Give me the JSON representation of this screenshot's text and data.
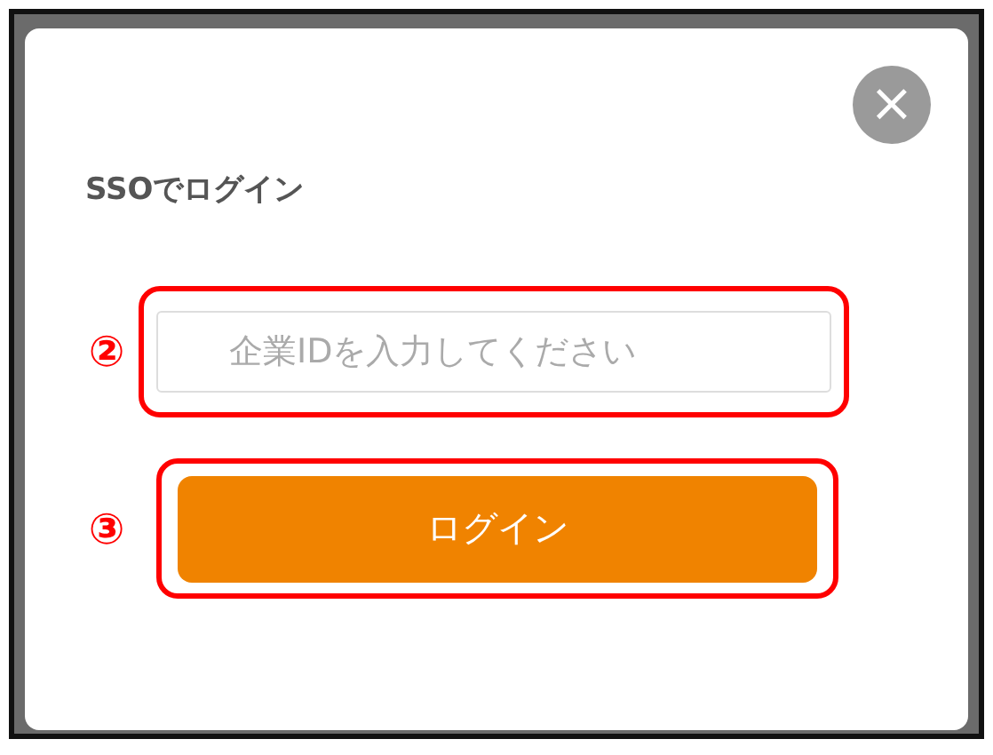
{
  "dialog": {
    "title": "SSOでログイン",
    "close_button": {
      "label": "×"
    },
    "company_id_field": {
      "marker": "②",
      "placeholder": "企業IDを入力してください"
    },
    "login_button": {
      "marker": "③",
      "label": "ログイン"
    }
  }
}
